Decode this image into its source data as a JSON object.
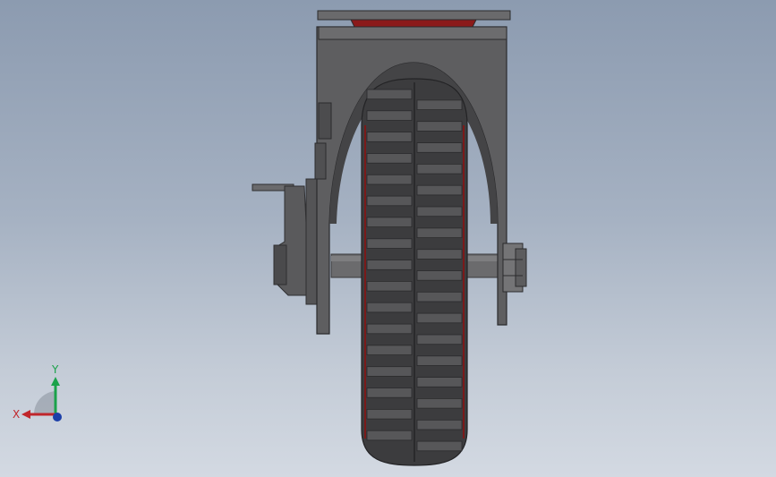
{
  "viewport": {
    "background_top": "#8c9bb0",
    "background_bottom": "#d3d9e2"
  },
  "model": {
    "part": "caster-wheel-assembly",
    "view": "front",
    "tread_blocks_per_column": 17,
    "colors": {
      "housing": "#5c5c5e",
      "housing_dark": "#3a3a3c",
      "tire": "#3c3c3e",
      "tire_edge": "#2a2a2c",
      "tread": "#575759",
      "rim_accent": "#7a1a1a",
      "axle": "#6e6e70",
      "top_plate_accent": "#8b1a1a"
    }
  },
  "triad": {
    "x_label": "X",
    "y_label": "Y",
    "x_color": "#c0262b",
    "y_color": "#1aa24a",
    "z_color": "#1c3fa8"
  }
}
